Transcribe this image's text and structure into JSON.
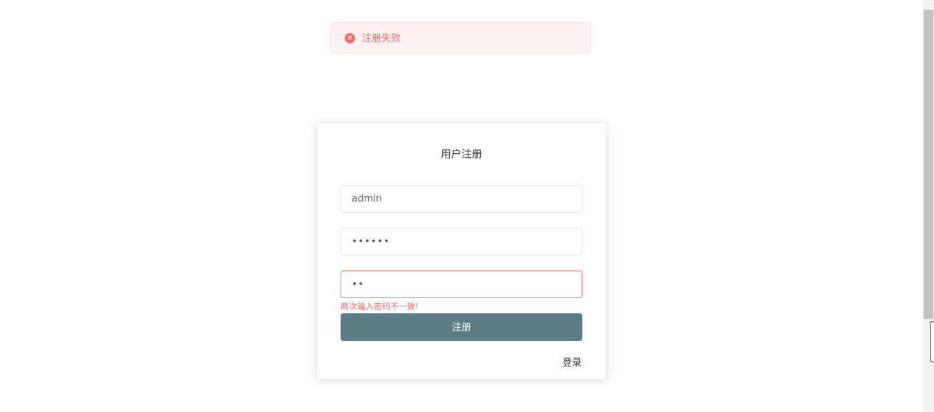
{
  "message": {
    "icon": "error-circle-icon",
    "text": "注册失败",
    "color": "#f56c6c"
  },
  "register_form": {
    "title": "用户注册",
    "username_value": "admin",
    "password_value": "••••••",
    "confirm_password_value": "••",
    "confirm_error": "两次输入密码不一致!",
    "submit_label": "注册",
    "login_link": "登录",
    "button_color": "#5f7d87"
  }
}
